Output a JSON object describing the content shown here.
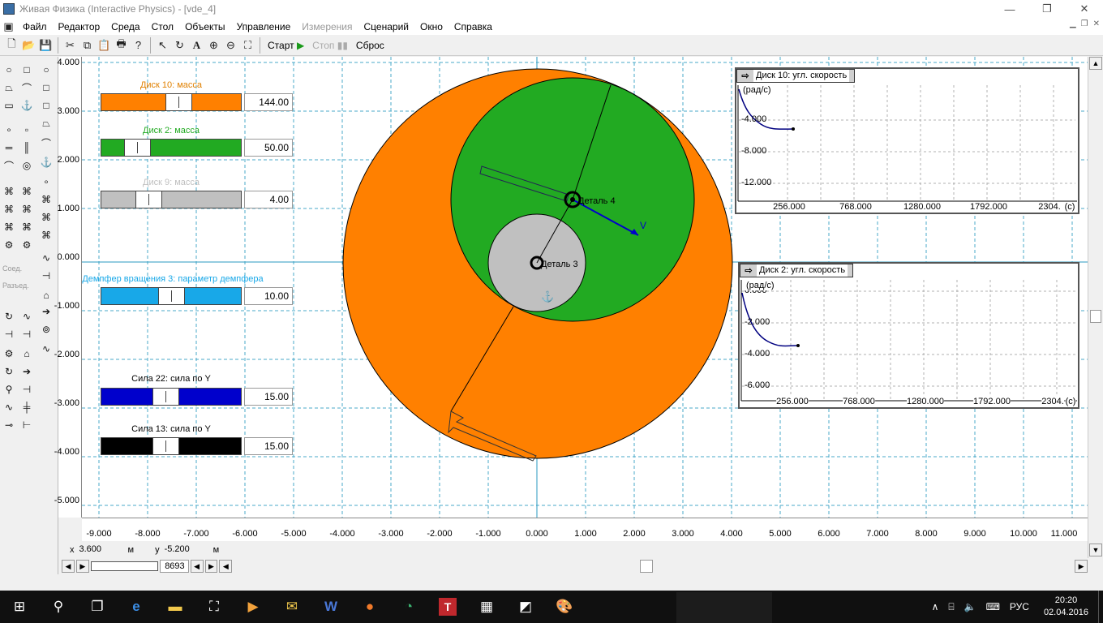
{
  "window": {
    "title": "Живая Физика (Interactive Physics) - [vde_4]"
  },
  "menu": [
    "Файл",
    "Редактор",
    "Среда",
    "Стол",
    "Объекты",
    "Управление",
    "Измерения",
    "Сценарий",
    "Окно",
    "Справка"
  ],
  "toolbar": {
    "start": "Старт",
    "stop": "Стоп",
    "reset": "Сброс"
  },
  "toolbox": {
    "join": "Соед.",
    "split": "Разъед."
  },
  "sliders": [
    {
      "label": "Диск 10: масса",
      "value": "144.00",
      "color": "#ff8000",
      "label_color": "#e08000",
      "thumb": 0.57
    },
    {
      "label": "Диск 2: масса",
      "value": "50.00",
      "color": "#22aa22",
      "label_color": "#22aa22",
      "thumb": 0.2
    },
    {
      "label": "Диск 9: масса",
      "value": "4.00",
      "color": "#c0c0c0",
      "label_color": "#c0c0c0",
      "thumb": 0.3
    },
    {
      "label": "Демпфер вращения 3: параметр демпфера",
      "value": "10.00",
      "color": "#18a8e8",
      "label_color": "#18a8e8",
      "thumb": 0.5
    },
    {
      "label": "Сила 22: сила по Y",
      "value": "15.00",
      "color": "#0000cc",
      "label_color": "#000000",
      "thumb": 0.45
    },
    {
      "label": "Сила 13: сила по Y",
      "value": "15.00",
      "color": "#000000",
      "label_color": "#000000",
      "thumb": 0.45
    }
  ],
  "canvas": {
    "y_ticks": [
      "4.000",
      "3.000",
      "2.000",
      "1.000",
      "0.000",
      "-1.000",
      "-2.000",
      "-3.000",
      "-4.000",
      "-5.000"
    ],
    "x_ticks": [
      "-9.000",
      "-8.000",
      "-7.000",
      "-6.000",
      "-5.000",
      "-4.000",
      "-3.000",
      "-2.000",
      "-1.000",
      "0.000",
      "1.000",
      "2.000",
      "3.000",
      "4.000",
      "5.000",
      "6.000",
      "7.000",
      "8.000",
      "9.000",
      "10.000",
      "11.000"
    ],
    "labels": {
      "part4": "Деталь 4",
      "part3": "Деталь 3",
      "velocity": "V"
    },
    "colors": {
      "big_disk": "#ff8000",
      "mid_disk": "#22aa22",
      "small_disk": "#c0c0c0"
    }
  },
  "graphs": [
    {
      "title": "Диск 10: угл. скорость",
      "unit_y": "(рад/с)",
      "y_ticks": [
        "-4.000",
        "-8.000",
        "-12.000"
      ],
      "x_ticks": [
        "256.000",
        "768.000",
        "1280.000",
        "1792.000",
        "2304."
      ],
      "unit_x": "(с)"
    },
    {
      "title": "Диск 2: угл. скорость",
      "unit_y": "(рад/с)",
      "y_ticks": [
        "0.000",
        "-2.000",
        "-4.000",
        "-6.000"
      ],
      "x_ticks": [
        "256.000",
        "768.000",
        "1280.000",
        "1792.000",
        "2304."
      ],
      "unit_x": "(с)"
    }
  ],
  "coords": {
    "x_label": "x",
    "x_value": "3.600",
    "x_unit": "м",
    "y_label": "y",
    "y_value": "-5.200",
    "y_unit": "м"
  },
  "frame_counter": "8693",
  "tray": {
    "lang": "РУС",
    "time": "20:20",
    "date": "02.04.2016"
  }
}
